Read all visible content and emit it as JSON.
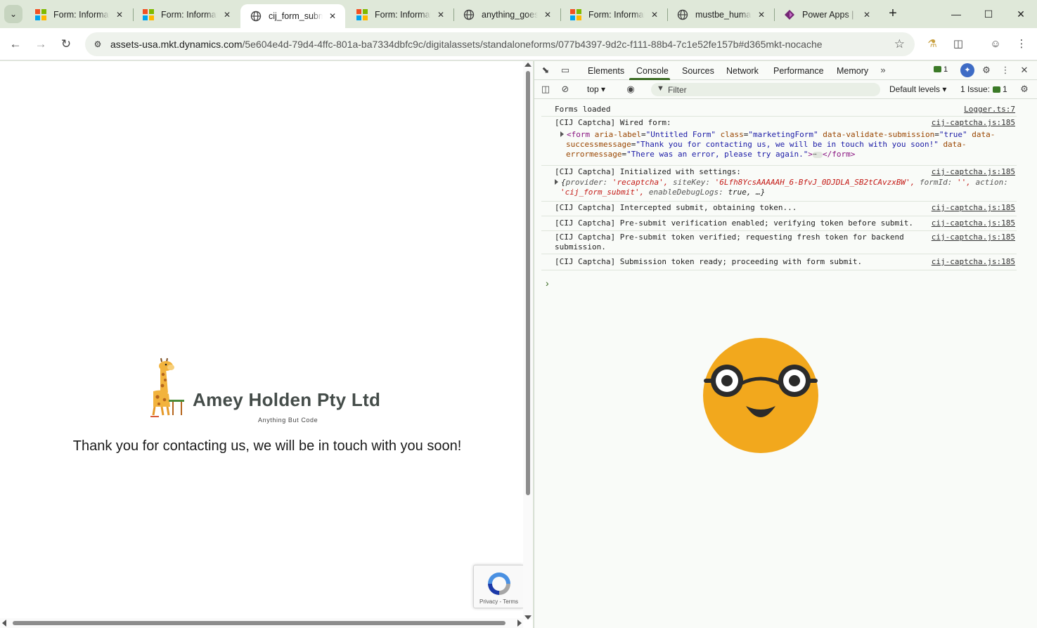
{
  "browser": {
    "tabs": [
      {
        "title": "Form: Informat",
        "favicon": "microsoft-icon",
        "active": false
      },
      {
        "title": "Form: Informat",
        "favicon": "microsoft-icon",
        "active": false
      },
      {
        "title": "cij_form_submi",
        "favicon": "globe-icon",
        "active": true
      },
      {
        "title": "Form: Informat",
        "favicon": "microsoft-icon",
        "active": false
      },
      {
        "title": "anything_goesC",
        "favicon": "globe-icon",
        "active": false
      },
      {
        "title": "Form: Informat",
        "favicon": "microsoft-icon",
        "active": false
      },
      {
        "title": "mustbe_human",
        "favicon": "globe-icon",
        "active": false
      },
      {
        "title": "Power Apps | S",
        "favicon": "power-apps-icon",
        "active": false
      }
    ],
    "url_host": "assets-usa.mkt.dynamics.com",
    "url_path": "/5e604e4d-79d4-4ffc-801a-ba7334dbfc9c/digitalassets/standaloneforms/077b4397-9d2c-f111-88b4-7c1e52fe157b#d365mkt-nocache"
  },
  "page": {
    "company_name": "Amey Holden Pty Ltd",
    "tagline": "Anything  But  Code",
    "thank_you": "Thank you for contacting us, we will be in touch with you soon!",
    "recaptcha_links": "Privacy - Terms"
  },
  "devtools": {
    "tabs": [
      "Elements",
      "Console",
      "Sources",
      "Network",
      "Performance",
      "Memory"
    ],
    "active_tab": "Console",
    "message_count": "1",
    "context": "top",
    "filter_placeholder": "Filter",
    "levels": "Default levels",
    "issues_label": "1 Issue:",
    "issues_count": "1",
    "messages": {
      "m1": {
        "text": "Forms loaded",
        "source": "Logger.ts:7"
      },
      "m2": {
        "text": "[CIJ Captcha] Wired form:",
        "source": "cij-captcha.js:185"
      },
      "m2_form": {
        "open": "<form",
        "a1": "aria-label",
        "v1": "\"Untitled Form\"",
        "a2": "class",
        "v2": "\"marketingForm\"",
        "a3": "data-validate-submission",
        "v3": "\"true\"",
        "a4": "data-successmessage",
        "v4": "\"Thank you for contacting us, we will be in touch with you soon!\"",
        "a5": "data-errormessage",
        "v5": "\"There was an error, please try again.\"",
        "close": "></form>"
      },
      "m3": {
        "text": "[CIJ Captcha] Initialized with settings:",
        "source": "cij-captcha.js:185"
      },
      "m3_obj": {
        "k1": "provider:",
        "v1": "'recaptcha',",
        "k2": "siteKey:",
        "v2": "'6Lfh8YcsAAAAAH_6-BfvJ_0DJDLA_SB2tCAvzxBW',",
        "k3": "formId:",
        "v3": "'',",
        "k4": "action:",
        "v4": "'cij_form_submit',",
        "k5": "enableDebugLogs:",
        "v5": "true, …}"
      },
      "m4": {
        "text": "[CIJ Captcha] Intercepted submit, obtaining token...",
        "source": "cij-captcha.js:185"
      },
      "m5": {
        "text": "[CIJ Captcha] Pre-submit verification enabled; verifying token before submit.",
        "source": "cij-captcha.js:185"
      },
      "m6": {
        "text": "[CIJ Captcha] Pre-submit token verified; requesting fresh token for backend submission.",
        "source": "cij-captcha.js:185"
      },
      "m7": {
        "text": "[CIJ Captcha] Submission token ready; proceeding with form submit.",
        "source": "cij-captcha.js:185"
      }
    }
  },
  "colors": {
    "frame": "#dfe8d9",
    "accent": "#386a20",
    "emoji_face": "#f2a81d"
  }
}
